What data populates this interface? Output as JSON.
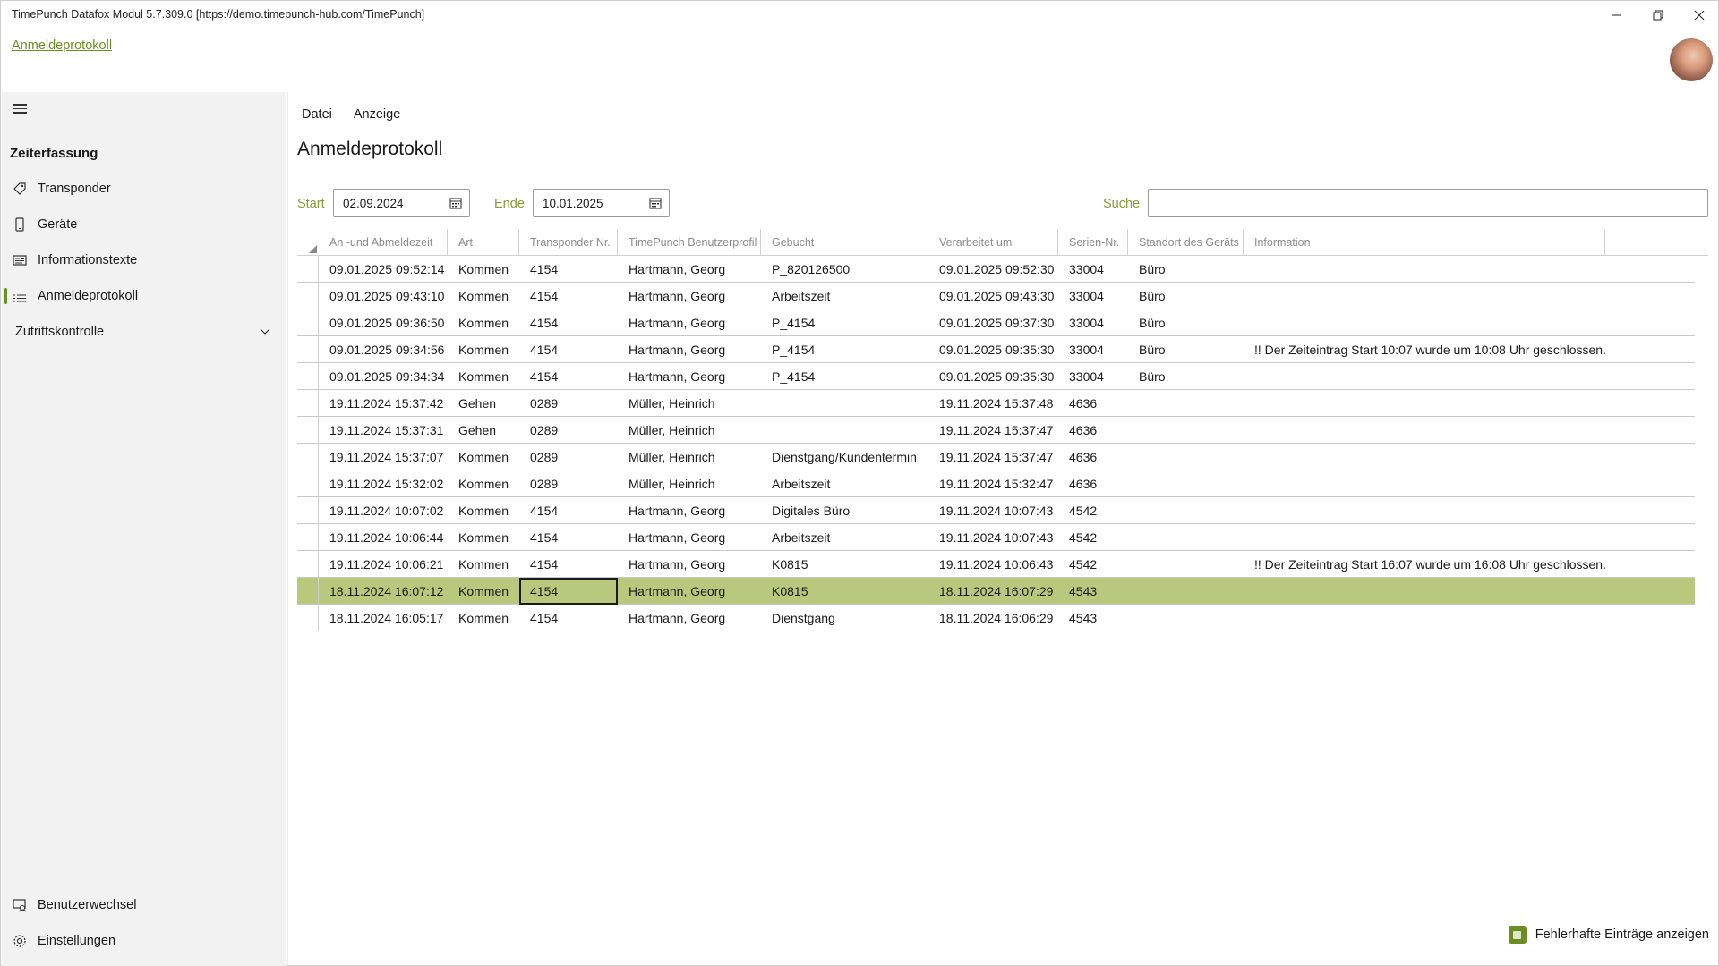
{
  "window": {
    "title": "TimePunch Datafox Modul 5.7.309.0 [https://demo.timepunch-hub.com/TimePunch]",
    "controls": {
      "minimize": "─",
      "restore": "❐",
      "close": "✕"
    }
  },
  "header": {
    "link": "Anmeldeprotokoll"
  },
  "sidebar": {
    "heading": "Zeiterfassung",
    "items": [
      {
        "label": "Transponder",
        "icon": "tag-icon"
      },
      {
        "label": "Geräte",
        "icon": "device-icon"
      },
      {
        "label": "Informationstexte",
        "icon": "info-text-icon"
      },
      {
        "label": "Anmeldeprotokoll",
        "icon": "list-icon",
        "active": true
      }
    ],
    "group": {
      "label": "Zutrittskontrolle"
    },
    "bottom": [
      {
        "label": "Benutzerwechsel",
        "icon": "user-switch-icon"
      },
      {
        "label": "Einstellungen",
        "icon": "gear-icon"
      }
    ]
  },
  "menu": {
    "file": "Datei",
    "view": "Anzeige"
  },
  "page": {
    "title": "Anmeldeprotokoll"
  },
  "filters": {
    "start_label": "Start",
    "start_value": "02.09.2024",
    "end_label": "Ende",
    "end_value": "10.01.2025",
    "search_label": "Suche",
    "search_value": ""
  },
  "grid": {
    "columns": [
      "An -und Abmeldezeit",
      "Art",
      "Transponder Nr.",
      "TimePunch Benutzerprofil",
      "Gebucht",
      "Verarbeitet um",
      "Serien-Nr.",
      "Standort des Geräts",
      "Information"
    ],
    "rows": [
      [
        "09.01.2025 09:52:14",
        "Kommen",
        "4154",
        "Hartmann, Georg",
        "P_820126500",
        "09.01.2025 09:52:30",
        "33004",
        "Büro",
        ""
      ],
      [
        "09.01.2025 09:43:10",
        "Kommen",
        "4154",
        "Hartmann, Georg",
        "Arbeitszeit",
        "09.01.2025 09:43:30",
        "33004",
        "Büro",
        ""
      ],
      [
        "09.01.2025 09:36:50",
        "Kommen",
        "4154",
        "Hartmann, Georg",
        "P_4154",
        "09.01.2025 09:37:30",
        "33004",
        "Büro",
        ""
      ],
      [
        "09.01.2025 09:34:56",
        "Kommen",
        "4154",
        "Hartmann, Georg",
        "P_4154",
        "09.01.2025 09:35:30",
        "33004",
        "Büro",
        "!! Der Zeiteintrag Start 10:07 wurde um 10:08 Uhr geschlossen."
      ],
      [
        "09.01.2025 09:34:34",
        "Kommen",
        "4154",
        "Hartmann, Georg",
        "P_4154",
        "09.01.2025 09:35:30",
        "33004",
        "Büro",
        ""
      ],
      [
        "19.11.2024 15:37:42",
        "Gehen",
        "0289",
        "Müller, Heinrich",
        "",
        "19.11.2024 15:37:48",
        "4636",
        "",
        ""
      ],
      [
        "19.11.2024 15:37:31",
        "Gehen",
        "0289",
        "Müller, Heinrich",
        "",
        "19.11.2024 15:37:47",
        "4636",
        "",
        ""
      ],
      [
        "19.11.2024 15:37:07",
        "Kommen",
        "0289",
        "Müller, Heinrich",
        "Dienstgang/Kundentermin",
        "19.11.2024 15:37:47",
        "4636",
        "",
        ""
      ],
      [
        "19.11.2024 15:32:02",
        "Kommen",
        "0289",
        "Müller, Heinrich",
        "Arbeitszeit",
        "19.11.2024 15:32:47",
        "4636",
        "",
        ""
      ],
      [
        "19.11.2024 10:07:02",
        "Kommen",
        "4154",
        "Hartmann, Georg",
        "Digitales Büro",
        "19.11.2024 10:07:43",
        "4542",
        "",
        ""
      ],
      [
        "19.11.2024 10:06:44",
        "Kommen",
        "4154",
        "Hartmann, Georg",
        "Arbeitszeit",
        "19.11.2024 10:07:43",
        "4542",
        "",
        ""
      ],
      [
        "19.11.2024 10:06:21",
        "Kommen",
        "4154",
        "Hartmann, Georg",
        "K0815",
        "19.11.2024 10:06:43",
        "4542",
        "",
        "!! Der Zeiteintrag Start 16:07 wurde um 16:08 Uhr geschlossen."
      ],
      [
        "18.11.2024 16:07:12",
        "Kommen",
        "4154",
        "Hartmann, Georg",
        "K0815",
        "18.11.2024 16:07:29",
        "4543",
        "",
        ""
      ],
      [
        "18.11.2024 16:05:17",
        "Kommen",
        "4154",
        "Hartmann, Georg",
        "Dienstgang",
        "18.11.2024 16:06:29",
        "4543",
        "",
        ""
      ]
    ],
    "selected_row": 12,
    "focused_column": 2
  },
  "footer": {
    "checkbox_label": "Fehlerhafte Einträge anzeigen",
    "checked": true
  },
  "colors": {
    "accent": "#6b8e23",
    "selected_row": "#b8c97e",
    "label": "#8a9a3a"
  }
}
